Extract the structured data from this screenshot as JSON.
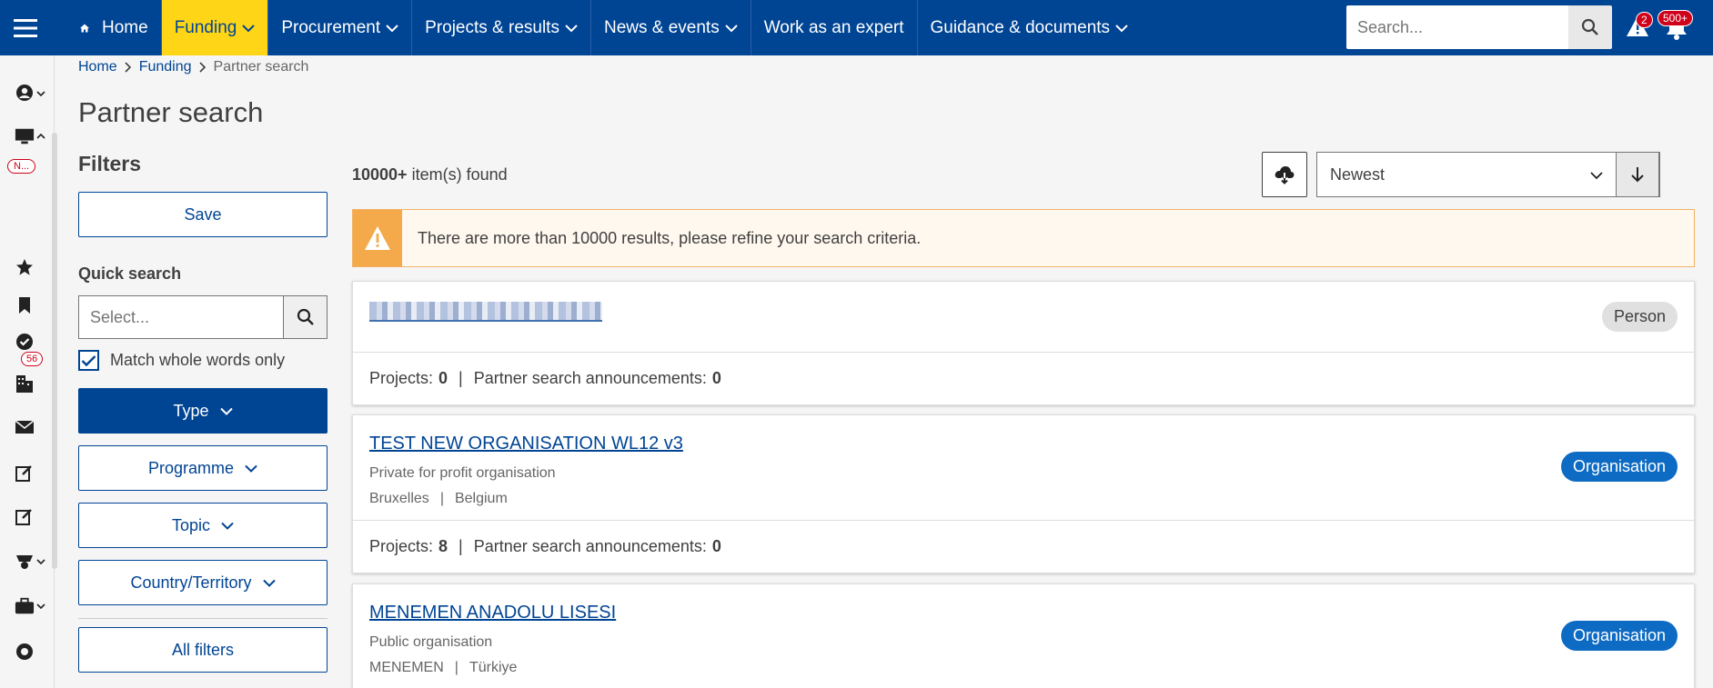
{
  "nav": {
    "items": [
      {
        "label": "Home"
      },
      {
        "label": "Funding"
      },
      {
        "label": "Procurement"
      },
      {
        "label": "Projects & results"
      },
      {
        "label": "News & events"
      },
      {
        "label": "Work as an expert"
      },
      {
        "label": "Guidance & documents"
      }
    ],
    "search_placeholder": "Search...",
    "alerts_count": "2",
    "notifications_count": "500+"
  },
  "rail": {
    "new_badge": "N...",
    "mail_count": "56"
  },
  "breadcrumb": [
    "Home",
    "Funding",
    "Partner search"
  ],
  "page_title": "Partner search",
  "filters": {
    "title": "Filters",
    "save_label": "Save",
    "quick_search_label": "Quick search",
    "quick_search_placeholder": "Select...",
    "match_whole_words": "Match whole words only",
    "type_label": "Type",
    "programme_label": "Programme",
    "topic_label": "Topic",
    "country_label": "Country/Territory",
    "all_filters_label": "All filters"
  },
  "results": {
    "count": "10000+",
    "count_suffix": " item(s) found",
    "sort_value": "Newest",
    "warning": "There are more than 10000 results, please refine your search criteria.",
    "items": [
      {
        "title": "",
        "type": "Person",
        "projects_label": "Projects:",
        "projects": "0",
        "announcements_label": "Partner search announcements:",
        "announcements": "0"
      },
      {
        "title": "TEST NEW ORGANISATION WL12 v3",
        "subtitle": "Private for profit organisation",
        "city": "Bruxelles",
        "country": "Belgium",
        "type": "Organisation",
        "projects_label": "Projects:",
        "projects": "8",
        "announcements_label": "Partner search announcements:",
        "announcements": "0"
      },
      {
        "title": "MENEMEN ANADOLU LISESI",
        "subtitle": "Public organisation",
        "city": "MENEMEN",
        "country": "Türkiye",
        "type": "Organisation"
      }
    ]
  },
  "colors": {
    "primary": "#004494",
    "accent": "#ffd617",
    "warning": "#f4a94b",
    "org_tag": "#0e6bc4"
  }
}
